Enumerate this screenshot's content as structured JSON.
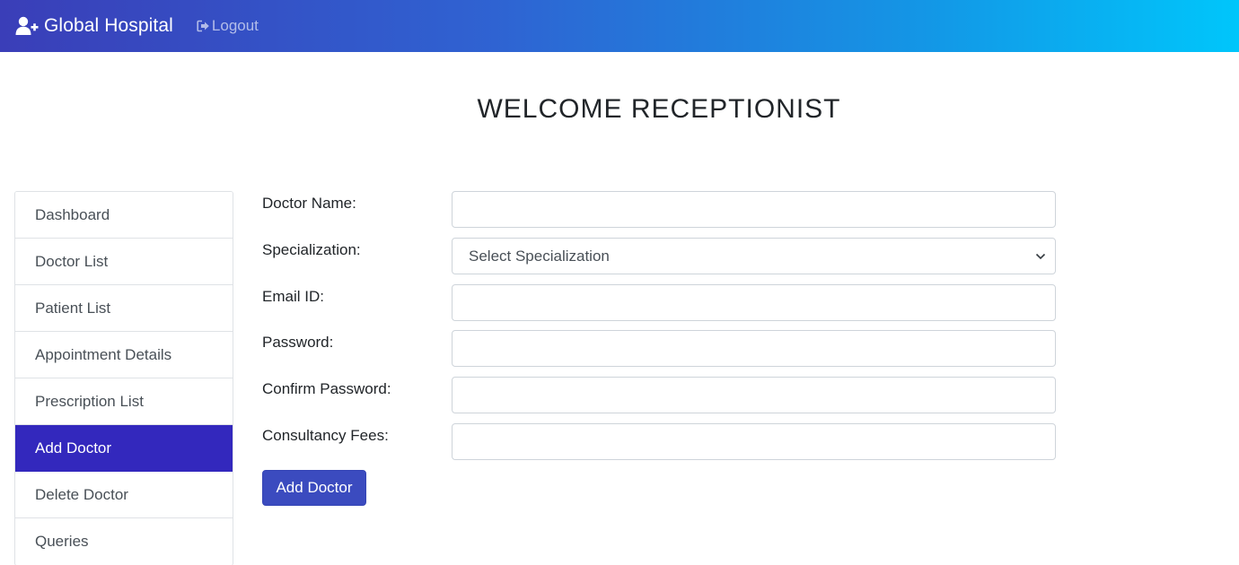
{
  "navbar": {
    "brand_icon": "user-plus-icon",
    "brand": "Global Hospital",
    "logout_icon": "sign-out-icon",
    "logout": "Logout",
    "gradient": [
      "#3a3eb8",
      "#00c6fb"
    ]
  },
  "heading": "WELCOME RECEPTIONIST",
  "sidebar": {
    "active_color": "#3328bd",
    "items": [
      {
        "label": "Dashboard"
      },
      {
        "label": "Doctor List"
      },
      {
        "label": "Patient List"
      },
      {
        "label": "Appointment Details"
      },
      {
        "label": "Prescription List"
      },
      {
        "label": "Add Doctor",
        "active": true
      },
      {
        "label": "Delete Doctor"
      },
      {
        "label": "Queries"
      }
    ]
  },
  "form": {
    "doctor_name": {
      "label": "Doctor Name:",
      "value": ""
    },
    "specialization": {
      "label": "Specialization:",
      "selected": "Select Specialization"
    },
    "email": {
      "label": "Email ID:",
      "value": ""
    },
    "password": {
      "label": "Password:",
      "value": ""
    },
    "confirm_password": {
      "label": "Confirm Password:",
      "value": ""
    },
    "fees": {
      "label": "Consultancy Fees:",
      "value": ""
    },
    "submit": "Add Doctor",
    "submit_color": "#3b4bbf"
  }
}
